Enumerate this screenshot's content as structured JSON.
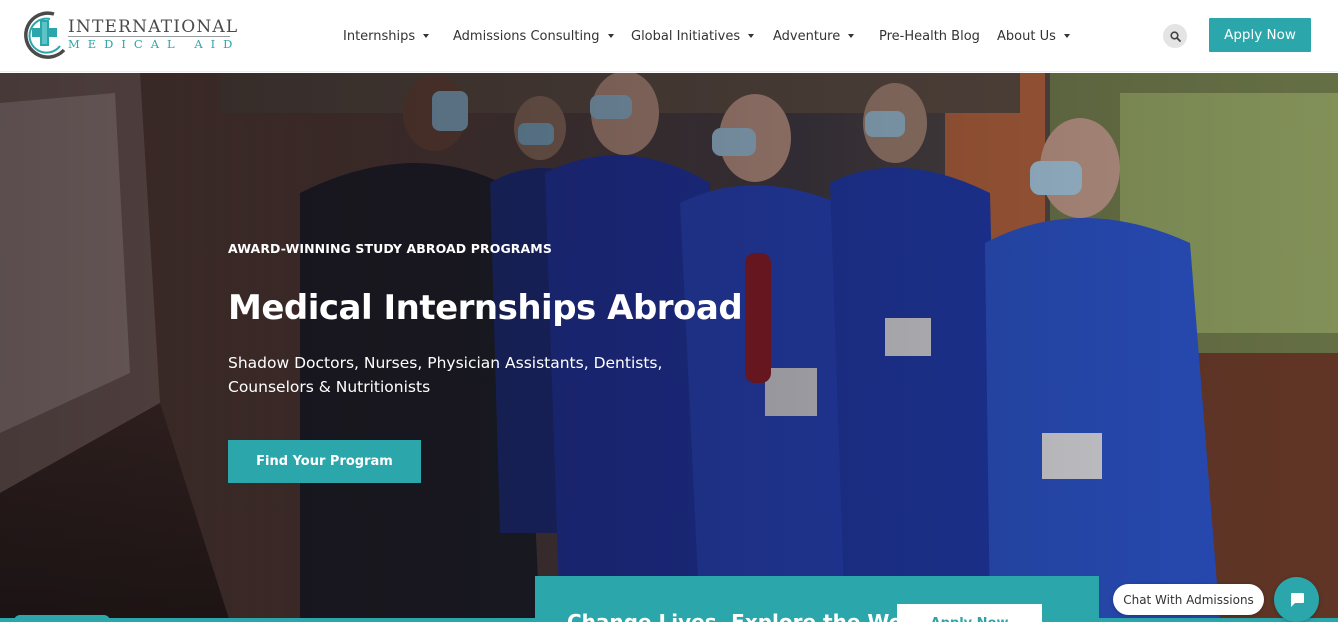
{
  "logo": {
    "line1": "INTERNATIONAL",
    "line2": "MEDICAL AID"
  },
  "nav": {
    "items": [
      {
        "label": "Internships",
        "has_dropdown": true
      },
      {
        "label": "Admissions Consulting",
        "has_dropdown": true
      },
      {
        "label": "Global Initiatives",
        "has_dropdown": true
      },
      {
        "label": "Adventure",
        "has_dropdown": true
      },
      {
        "label": "Pre-Health Blog",
        "has_dropdown": false
      },
      {
        "label": "About Us",
        "has_dropdown": true
      }
    ],
    "search_icon": "search-icon",
    "apply_label": "Apply Now"
  },
  "hero": {
    "eyebrow": "AWARD-WINNING STUDY ABROAD PROGRAMS",
    "title": "Medical Internships Abroad",
    "subtitle": "Shadow Doctors, Nurses, Physician Assistants, Dentists, Counselors & Nutritionists",
    "cta_label": "Find Your Program"
  },
  "promo": {
    "text": "Change Lives. Explore the World™",
    "button_label": "Apply Now"
  },
  "chat": {
    "label": "Chat With Admissions",
    "icon": "chat-bubble-icon"
  },
  "colors": {
    "accent": "#2ba6aa",
    "header_bg": "#ffffff",
    "nav_text": "#333333"
  }
}
